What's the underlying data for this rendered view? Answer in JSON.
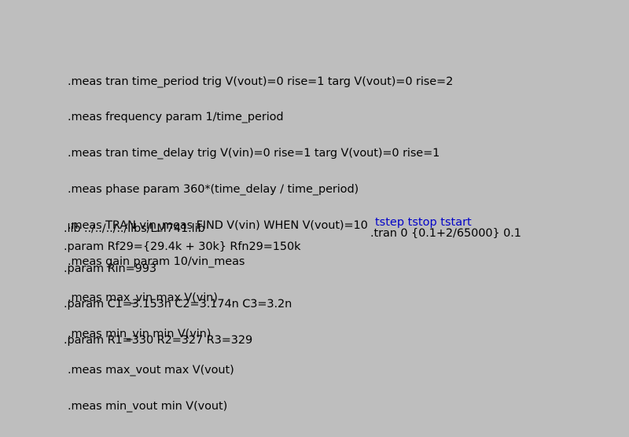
{
  "colors": {
    "background": "#bebebe",
    "text": "#000000",
    "hint": "#0000c8"
  },
  "directives": {
    "meas": [
      ".meas tran time_period trig V(vout)=0 rise=1 targ V(vout)=0 rise=2",
      ".meas frequency param 1/time_period",
      ".meas tran time_delay trig V(vin)=0 rise=1 targ V(vout)=0 rise=1",
      ".meas phase param 360*(time_delay / time_period)",
      ".meas TRAN vin_meas FIND V(vin) WHEN V(vout)=10",
      ".meas gain param 10/vin_meas",
      ".meas max_vin max V(vin)",
      ".meas min_vin min V(vin)",
      ".meas max_vout max V(vout)",
      ".meas min_vout min V(vout)"
    ],
    "lib": ".lib ../../../../libs/LM741.lib",
    "param_rf": ".param Rf29={29.4k + 30k} Rfn29=150k",
    "params": [
      ".param Rin=993",
      ".param C1=3.153n C2=3.174n C3=3.2n",
      ".param R1=330 R2=327 R3=329"
    ],
    "tran": ".tran 0 {0.1+2/65000} 0.1",
    "tran_hint": "tstep tstop tstart"
  }
}
